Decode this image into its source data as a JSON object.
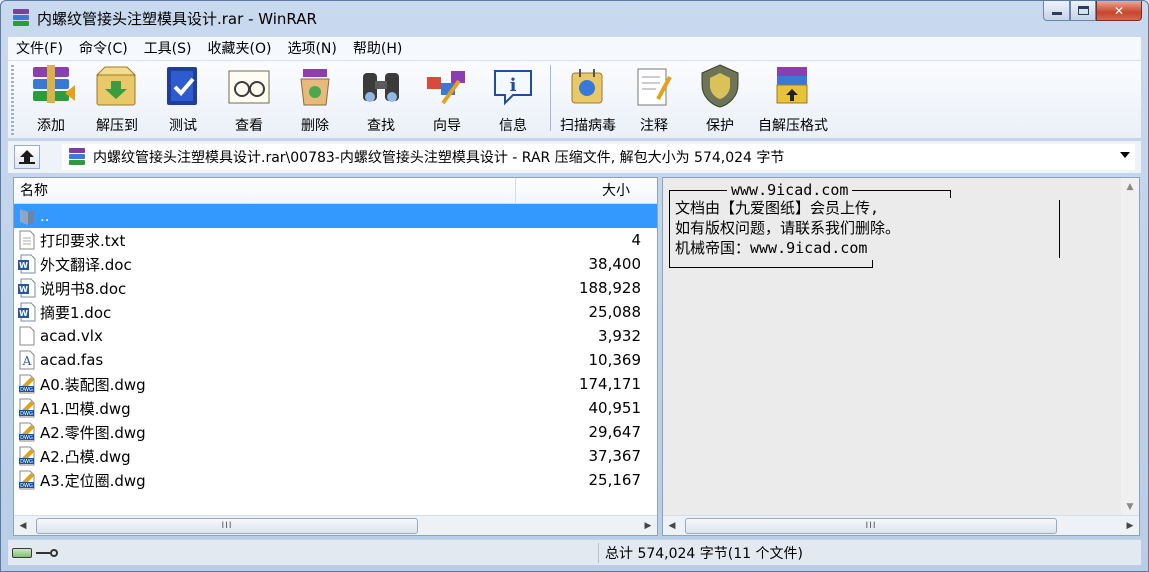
{
  "window": {
    "title": "内螺纹管接头注塑模具设计.rar - WinRAR"
  },
  "menu": [
    "文件(F)",
    "命令(C)",
    "工具(S)",
    "收藏夹(O)",
    "选项(N)",
    "帮助(H)"
  ],
  "toolbar": {
    "group1": [
      {
        "label": "添加",
        "icon": "add-archive-icon"
      },
      {
        "label": "解压到",
        "icon": "extract-to-icon"
      },
      {
        "label": "测试",
        "icon": "test-icon"
      },
      {
        "label": "查看",
        "icon": "view-icon"
      },
      {
        "label": "删除",
        "icon": "delete-icon"
      },
      {
        "label": "查找",
        "icon": "find-icon"
      },
      {
        "label": "向导",
        "icon": "wizard-icon"
      },
      {
        "label": "信息",
        "icon": "info-icon"
      }
    ],
    "group2": [
      {
        "label": "扫描病毒",
        "icon": "virus-scan-icon"
      },
      {
        "label": "注释",
        "icon": "comment-icon"
      },
      {
        "label": "保护",
        "icon": "protect-icon"
      },
      {
        "label": "自解压格式",
        "icon": "sfx-icon"
      }
    ]
  },
  "address": {
    "text": "内螺纹管接头注塑模具设计.rar\\00783-内螺纹管接头注塑模具设计 - RAR 压缩文件, 解包大小为 574,024 字节"
  },
  "filelist": {
    "columns": {
      "name": "名称",
      "size": "大小"
    },
    "rows": [
      {
        "name": "..",
        "size": "",
        "type": "folder-up",
        "selected": true
      },
      {
        "name": "打印要求.txt",
        "size": "4",
        "type": "txt"
      },
      {
        "name": "外文翻译.doc",
        "size": "38,400",
        "type": "doc"
      },
      {
        "name": "说明书8.doc",
        "size": "188,928",
        "type": "doc"
      },
      {
        "name": "摘要1.doc",
        "size": "25,088",
        "type": "doc"
      },
      {
        "name": "acad.vlx",
        "size": "3,932",
        "type": "blank"
      },
      {
        "name": "acad.fas",
        "size": "10,369",
        "type": "fas"
      },
      {
        "name": "A0.装配图.dwg",
        "size": "174,171",
        "type": "dwg"
      },
      {
        "name": "A1.凹模.dwg",
        "size": "40,951",
        "type": "dwg"
      },
      {
        "name": "A2.零件图.dwg",
        "size": "29,647",
        "type": "dwg"
      },
      {
        "name": "A2.凸模.dwg",
        "size": "37,367",
        "type": "dwg"
      },
      {
        "name": "A3.定位圈.dwg",
        "size": "25,167",
        "type": "dwg"
      }
    ]
  },
  "comment": {
    "title": "www.9icad.com",
    "lines": [
      "文档由【九爱图纸】会员上传,",
      "如有版权问题，请联系我们删除。",
      "机械帝国：www.9icad.com"
    ]
  },
  "status": {
    "summary": "总计 574,024 字节(11 个文件)"
  },
  "colors": {
    "selection": "#3399ff",
    "frame": "#b9cde6"
  }
}
